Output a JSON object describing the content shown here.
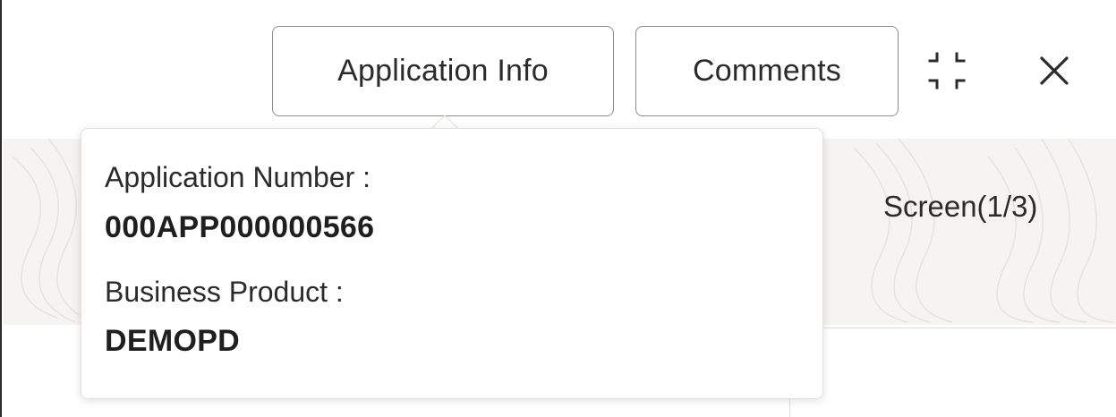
{
  "header": {
    "application_info_label": "Application Info",
    "comments_label": "Comments",
    "collapse_icon": "collapse-icon",
    "close_icon": "close-icon"
  },
  "screen_counter": "Screen(1/3)",
  "popover": {
    "application_number_label": "Application Number :",
    "application_number_value": "000APP000000566",
    "business_product_label": "Business Product :",
    "business_product_value": "DEMOPD"
  },
  "colors": {
    "text": "#2b2b2b",
    "button_border": "#8c8c8c",
    "band_background": "#f5f4f2"
  }
}
